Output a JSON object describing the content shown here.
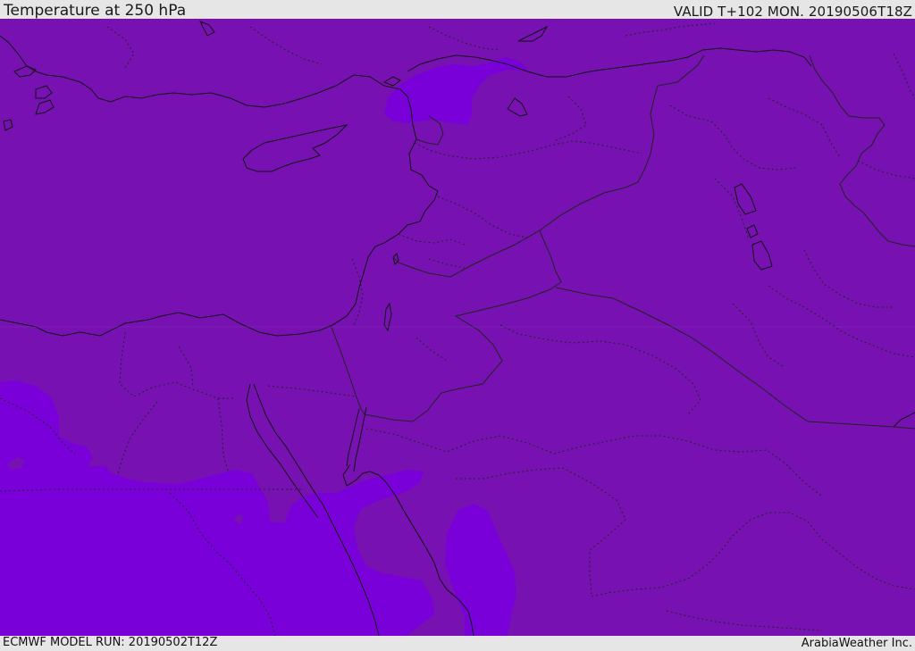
{
  "header": {
    "title": "Temperature at 250 hPa",
    "valid": "VALID T+102 MON. 20190506T18Z"
  },
  "footer": {
    "model_run": "ECMWF MODEL RUN: 20190502T12Z",
    "brand": "ArabiaWeather Inc."
  },
  "map": {
    "field": "Temperature",
    "level": "250 hPa",
    "colors": {
      "base_fill": "#7711b2",
      "cold_fill": "#7a00d9",
      "coastline": "#111111",
      "border": "#222222"
    }
  }
}
